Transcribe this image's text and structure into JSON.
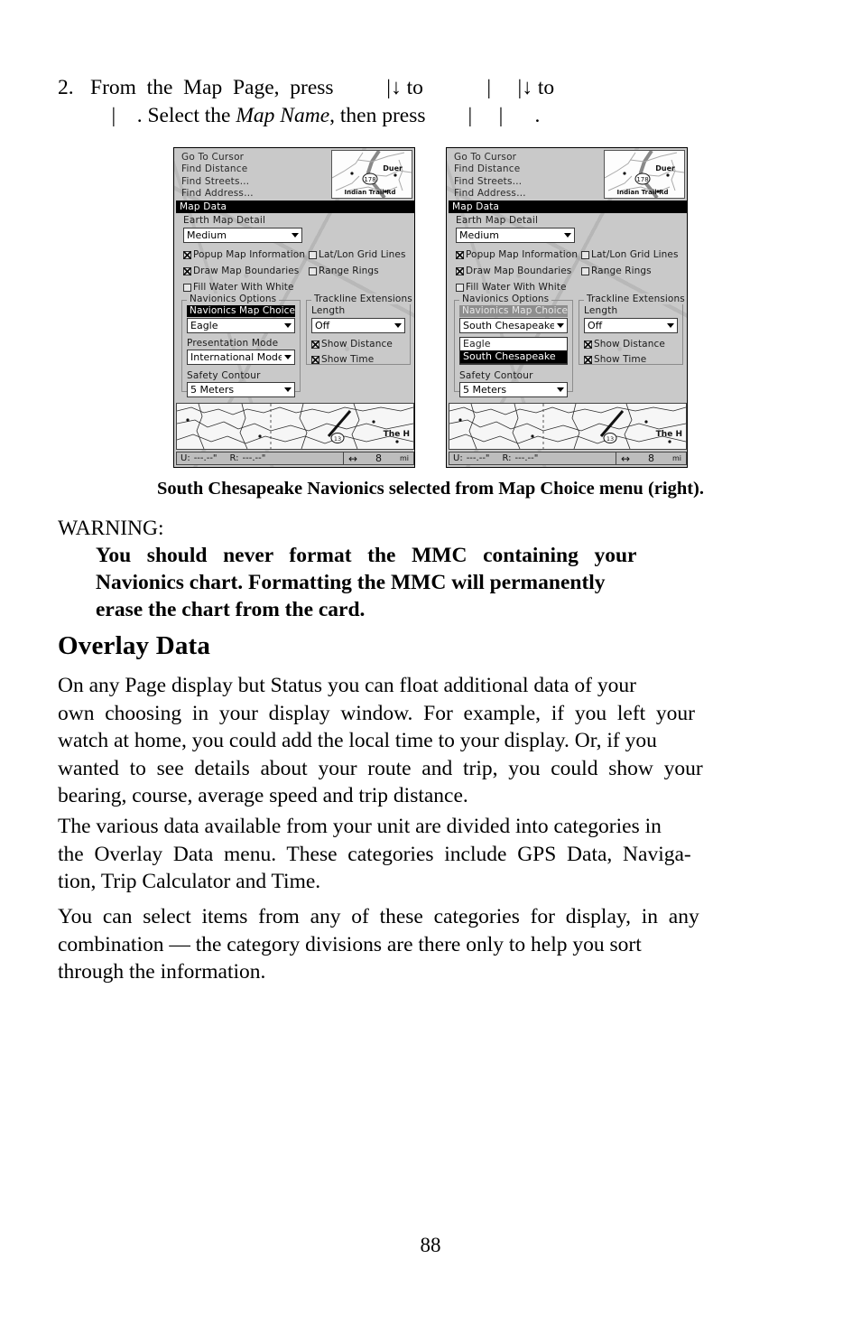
{
  "step": {
    "number": "2.",
    "line1": "From  the  Map  Page,  press          |↓ to            |     |↓ to",
    "line2_a": "    |    . Select the ",
    "line2_italic": "Map Name",
    "line2_b": ", then press        |     |      ."
  },
  "units": {
    "left": {
      "find_menu": [
        "Go To Cursor",
        "Find Distance",
        "Find Streets…",
        "Find Address…"
      ],
      "minimap": {
        "place_label": "Duer",
        "road_label": "Indian Trail Rd",
        "highway_shield": "178"
      },
      "title": "Map Data",
      "earth_map_detail": {
        "label": "Earth Map Detail",
        "value": "Medium"
      },
      "checkboxes": [
        {
          "label": "Popup Map Information",
          "checked": true
        },
        {
          "label": "Draw Map Boundaries",
          "checked": true
        },
        {
          "label": "Fill Water With White",
          "checked": false
        },
        {
          "label": "Lat/Lon Grid Lines",
          "checked": false
        },
        {
          "label": "Range Rings",
          "checked": false
        }
      ],
      "navionics_group": {
        "title": "Navionics Options",
        "map_choice_label": "Navionics Map Choice",
        "map_choice_label_state": "active",
        "map_choice_value": "Eagle",
        "presentation_label": "Presentation Mode",
        "presentation_value": "International Mode",
        "safety_label": "Safety Contour",
        "safety_value": "5 Meters"
      },
      "trackline_group": {
        "title": "Trackline Extensions",
        "length_label": "Length",
        "length_value": "Off",
        "show_distance": {
          "label": "Show Distance",
          "checked": true
        },
        "show_time": {
          "label": "Show Time",
          "checked": true
        }
      },
      "dropdown_open": false,
      "status": {
        "u_label": "U:",
        "u_value": "---.--\"",
        "r_label": "R:",
        "r_value": "---.--\"",
        "zoom_value": "8",
        "zoom_unit": "mi",
        "strip_labels": [
          "The H",
          "13"
        ]
      }
    },
    "right": {
      "find_menu": [
        "Go To Cursor",
        "Find Distance",
        "Find Streets…",
        "Find Address…"
      ],
      "minimap": {
        "place_label": "Duer",
        "road_label": "Indian Trail Rd",
        "highway_shield": "178"
      },
      "title": "Map Data",
      "earth_map_detail": {
        "label": "Earth Map Detail",
        "value": "Medium"
      },
      "checkboxes": [
        {
          "label": "Popup Map Information",
          "checked": true
        },
        {
          "label": "Draw Map Boundaries",
          "checked": true
        },
        {
          "label": "Fill Water With White",
          "checked": false
        },
        {
          "label": "Lat/Lon Grid Lines",
          "checked": false
        },
        {
          "label": "Range Rings",
          "checked": false
        }
      ],
      "navionics_group": {
        "title": "Navionics Options",
        "map_choice_label": "Navionics Map Choice",
        "map_choice_label_state": "inactive",
        "map_choice_value": "South Chesapeake",
        "presentation_label": "Presentation Mode",
        "presentation_value": "International Mode",
        "safety_label": "Safety Contour",
        "safety_value": "5 Meters"
      },
      "trackline_group": {
        "title": "Trackline Extensions",
        "length_label": "Length",
        "length_value": "Off",
        "show_distance": {
          "label": "Show Distance",
          "checked": true
        },
        "show_time": {
          "label": "Show Time",
          "checked": true
        }
      },
      "dropdown_open": true,
      "dropdown_options": [
        {
          "label": "Eagle",
          "selected": false
        },
        {
          "label": "South Chesapeake",
          "selected": true
        }
      ],
      "status": {
        "u_label": "U:",
        "u_value": "---.--\"",
        "r_label": "R:",
        "r_value": "---.--\"",
        "zoom_value": "8",
        "zoom_unit": "mi",
        "strip_labels": [
          "The H",
          "13"
        ]
      }
    }
  },
  "caption": "South Chesapeake Navionics selected from Map Choice menu (right).",
  "warning": {
    "heading": "WARNING:",
    "line1": "You   should   never   format   the   MMC   containing   your",
    "line2": "Navionics chart. Formatting the MMC will permanently",
    "line3": "erase the chart from the card."
  },
  "section_heading": "Overlay Data",
  "paragraphs": {
    "p1": [
      "On any Page display but Status you can float additional data of your",
      "own  choosing  in  your  display  window.  For  example,  if  you  left  your",
      "watch at home, you could add the local time to your display. Or, if you",
      "wanted  to  see  details  about  your  route  and  trip,  you  could  show  your",
      "bearing, course, average speed and trip distance."
    ],
    "p2": [
      "The various data available from your unit are divided into categories in",
      "the  Overlay  Data  menu.  These  categories  include  GPS  Data,  Naviga-",
      "tion, Trip Calculator and Time."
    ],
    "p3": [
      "You  can  select  items  from  any  of  these  categories  for  display,  in  any",
      "combination — the category divisions are there only to help you sort",
      "through the information."
    ]
  },
  "page_number": "88"
}
